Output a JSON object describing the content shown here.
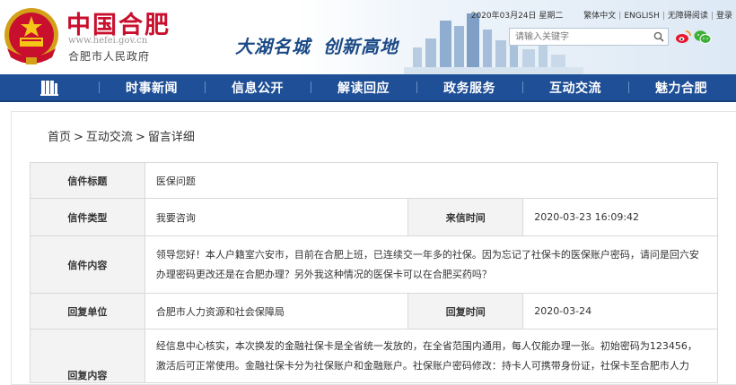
{
  "header": {
    "logo_title": "中国合肥",
    "logo_url": "www.hefei.gov.cn",
    "logo_subtitle": "合肥市人民政府",
    "slogan_part1": "大湖名城",
    "slogan_part2": "创新高地",
    "date": "2020年03月24日 星期二",
    "links": [
      "繁体中文",
      "ENGLISH",
      "无障碍阅读",
      "登录"
    ],
    "separator": "|",
    "search_placeholder": "请输入关键字",
    "icons": {
      "emblem": "national-emblem-icon",
      "search": "search-icon",
      "weibo": "weibo-icon",
      "wechat": "wechat-icon"
    }
  },
  "nav": {
    "items": [
      "时事新闻",
      "信息公开",
      "解读回应",
      "政务服务",
      "互动交流",
      "魅力合肥"
    ]
  },
  "breadcrumb": {
    "items": [
      "首页",
      "互动交流",
      "留言详细"
    ],
    "separator": ">"
  },
  "detail": {
    "title_label": "信件标题",
    "title_value": "医保问题",
    "type_label": "信件类型",
    "type_value": "我要咨询",
    "time_label": "来信时间",
    "time_value": "2020-03-23 16:09:42",
    "content_label": "信件内容",
    "content_value": "领导您好！本人户籍室六安市，目前在合肥上班，已连续交一年多的社保。因为忘记了社保卡的医保账户密码，请问是回六安办理密码更改还是在合肥办理？另外我这种情况的医保卡可以在合肥买药吗？",
    "unit_label": "回复单位",
    "unit_value": "合肥市人力资源和社会保障局",
    "reply_time_label": "回复时间",
    "reply_time_value": "2020-03-24",
    "reply_label": "回复内容",
    "reply_value": "经信息中心核实，本次换发的金融社保卡是全省统一发放的，在全省范围内通用，每人仅能办理一张。初始密码为123456，激活后可正常使用。金融社保卡分为社保账户和金融账户。社保账户密码修改：持卡人可携带身份证，社保卡至合肥市人力"
  },
  "colors": {
    "nav_bg": "#1f4f96",
    "logo_red": "#c8102e",
    "label_text": "#8b1a1a",
    "label_bg": "#f3f3f3",
    "slogan_blue": "#1c4a86"
  }
}
